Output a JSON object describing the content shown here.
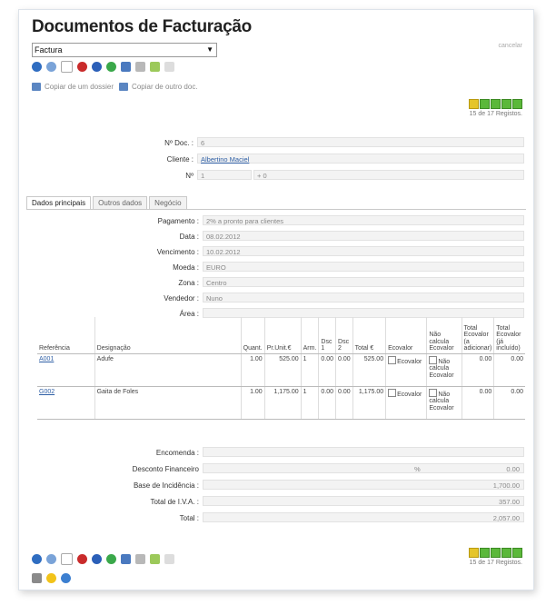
{
  "title": "Documentos de Facturação",
  "doc_type": "Factura",
  "cancel_link": "cancelar",
  "copy": {
    "from_dossier": "Copiar de um dossier",
    "from_other": "Copiar de outro doc."
  },
  "pager": {
    "top": "15 de 17 Registos.",
    "bottom": "15 de 17 Registos."
  },
  "header": {
    "doc_no": {
      "label": "Nº Doc. :",
      "value": "6"
    },
    "cliente": {
      "label": "Cliente :",
      "value": "Albertino Maciel"
    },
    "no": {
      "label": "Nº",
      "value": "1",
      "extra": "+ 0"
    }
  },
  "tabs": [
    "Dados principais",
    "Outros dados",
    "Negócio"
  ],
  "fields": [
    {
      "label": "Pagamento :",
      "value": "2% a pronto para clientes"
    },
    {
      "label": "Data :",
      "value": "08.02.2012"
    },
    {
      "label": "Vencimento :",
      "value": "10.02.2012"
    },
    {
      "label": "Moeda :",
      "value": "EURO"
    },
    {
      "label": "Zona :",
      "value": "Centro"
    },
    {
      "label": "Vendedor :",
      "value": "Nuno"
    },
    {
      "label": "Área :",
      "value": ""
    }
  ],
  "table": {
    "headers": [
      "Referência",
      "Designação",
      "Quant.",
      "Pr.Unit.€",
      "Arm.",
      "Dsc 1",
      "Dsc 2",
      "Total €",
      "Ecovalor",
      "Não calcula Ecovalor",
      "Total Ecovalor (a adicionar)",
      "Total Ecovalor (já incluído)"
    ],
    "rows": [
      {
        "ref": "A001",
        "desig": "Adufe",
        "quant": "1.00",
        "pr": "525.00",
        "arm": "1",
        "d1": "0.00",
        "d2": "0.00",
        "total": "525.00",
        "eco": "Ecovalor",
        "nao": "Não calcula Ecovalor",
        "t1": "0.00",
        "t2": "0.00"
      },
      {
        "ref": "G002",
        "desig": "Gaita de Foles",
        "quant": "1.00",
        "pr": "1,175.00",
        "arm": "1",
        "d1": "0.00",
        "d2": "0.00",
        "total": "1,175.00",
        "eco": "Ecovalor",
        "nao": "Não calcula Ecovalor",
        "t1": "0.00",
        "t2": "0.00"
      }
    ]
  },
  "totals": [
    {
      "label": "Encomenda :",
      "value": ""
    },
    {
      "label": "Desconto Financeiro",
      "pct": "%",
      "value": "0.00"
    },
    {
      "label": "Base de Incidência :",
      "value": "1,700.00"
    },
    {
      "label": "Total de I.V.A. :",
      "value": "357.00"
    },
    {
      "label": "Total :",
      "value": "2,057.00"
    }
  ],
  "icons": [
    "arrow-icon",
    "search-icon",
    "new-doc-icon",
    "delete-icon",
    "info-icon",
    "recycle-icon",
    "print-icon",
    "tools-icon",
    "export-icon",
    "edit-icon"
  ],
  "colors": {
    "accent": "#2f5fa5",
    "pager_green": "#5bb83a"
  }
}
